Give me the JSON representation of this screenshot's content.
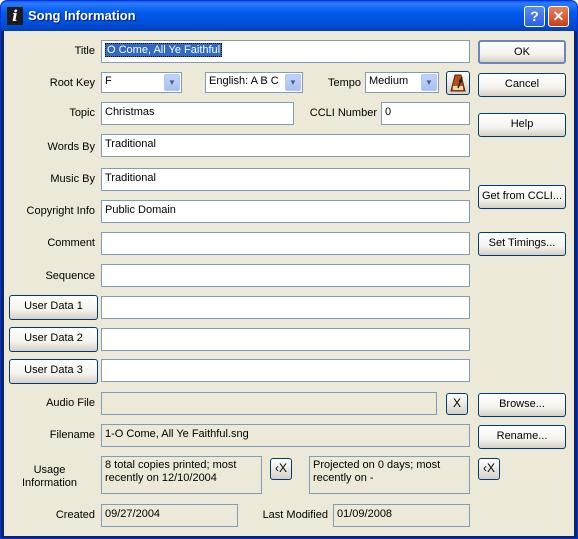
{
  "window": {
    "title": "Song Information",
    "help_glyph": "?",
    "close_glyph": "✕",
    "icon": "info-icon",
    "icon_glyph": "i"
  },
  "form": {
    "title_label": "Title",
    "title_value": "O Come, All Ye Faithful",
    "root_key_label": "Root Key",
    "root_key_value": "F",
    "notation_value": "English: A B C",
    "tempo_label": "Tempo",
    "tempo_value": "Medium",
    "topic_label": "Topic",
    "topic_value": "Christmas",
    "ccli_label": "CCLI Number",
    "ccli_value": "0",
    "words_by_label": "Words By",
    "words_by_value": "Traditional",
    "music_by_label": "Music By",
    "music_by_value": "Traditional",
    "copyright_label": "Copyright Info",
    "copyright_value": "Public Domain",
    "comment_label": "Comment",
    "comment_value": "",
    "sequence_label": "Sequence",
    "sequence_value": "",
    "user_data_1_label": "User Data 1",
    "user_data_1_value": "",
    "user_data_2_label": "User Data 2",
    "user_data_2_value": "",
    "user_data_3_label": "User Data 3",
    "user_data_3_value": "",
    "audio_file_label": "Audio File",
    "audio_file_value": "",
    "audio_clear_glyph": "X",
    "filename_label": "Filename",
    "filename_value": "1-O Come, All Ye Faithful.sng",
    "usage_label_1": "Usage",
    "usage_label_2": "Information",
    "usage_printed": "8 total copies printed; most recently on 12/10/2004",
    "usage_projected": "Projected on 0 days; most recently on -",
    "reset_glyph": "‹X",
    "created_label": "Created",
    "created_value": "09/27/2004",
    "modified_label": "Last Modified",
    "modified_value": "01/09/2008"
  },
  "buttons": {
    "ok": "OK",
    "cancel": "Cancel",
    "help": "Help",
    "get_from_ccli": "Get from CCLI...",
    "set_timings": "Set Timings...",
    "browse": "Browse...",
    "rename": "Rename..."
  },
  "icons": {
    "tempo_tool": "metronome-icon",
    "dropdown": "chevron-down-icon"
  },
  "colors": {
    "title_bar": "#0054e3",
    "dialog_bg": "#ece9d8",
    "selection": "#316ac5"
  }
}
